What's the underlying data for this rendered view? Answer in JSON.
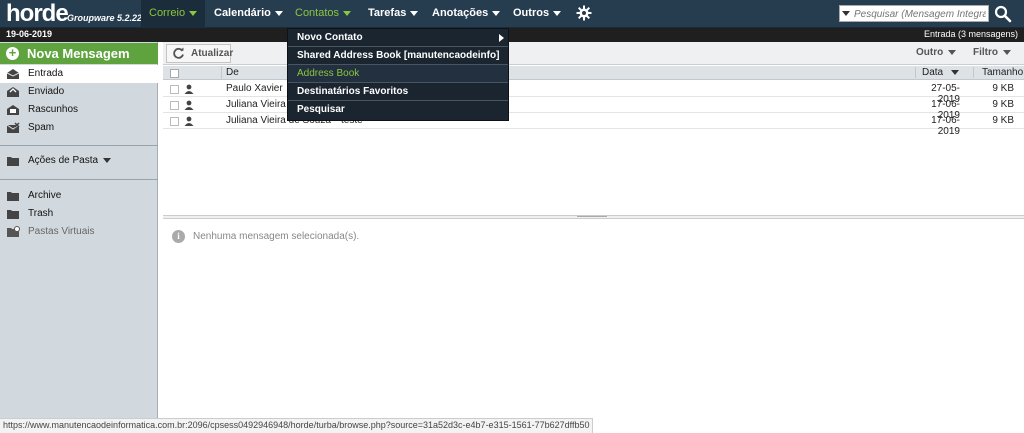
{
  "app": {
    "logo": "horde",
    "version": "Groupware 5.2.22"
  },
  "topmenu": {
    "items": [
      {
        "label": "Correio"
      },
      {
        "label": "Calendário"
      },
      {
        "label": "Contatos"
      },
      {
        "label": "Tarefas"
      },
      {
        "label": "Anotações"
      },
      {
        "label": "Outros"
      }
    ],
    "settings_icon": "gear-icon"
  },
  "search": {
    "placeholder": "Pesquisar (Mensagem Integral)",
    "button_icon": "search-icon"
  },
  "subbar": {
    "date": "19-06-2019",
    "mailbox_status": "Entrada (3 mensagens)"
  },
  "sidebar": {
    "new_message": "Nova Mensagem",
    "folders": [
      {
        "label": "Entrada",
        "icon": "inbox-icon"
      },
      {
        "label": "Enviado",
        "icon": "sent-icon"
      },
      {
        "label": "Rascunhos",
        "icon": "drafts-icon"
      },
      {
        "label": "Spam",
        "icon": "spam-icon"
      }
    ],
    "folder_actions": "Ações de Pasta",
    "other_folders": [
      {
        "label": "Archive",
        "icon": "folder-icon"
      },
      {
        "label": "Trash",
        "icon": "folder-icon"
      },
      {
        "label": "Pastas Virtuais",
        "icon": "virtual-folder-icon"
      }
    ]
  },
  "toolbar": {
    "refresh": "Atualizar",
    "other": "Outro",
    "filter": "Filtro"
  },
  "list": {
    "columns": {
      "from": "De",
      "date": "Data",
      "size": "Tamanho"
    },
    "rows": [
      {
        "from": "Paulo Xavier",
        "subject": "",
        "date": "27-05-2019",
        "size": "9 KB"
      },
      {
        "from": "Juliana Vieira d",
        "subject": "",
        "date": "17-06-2019",
        "size": "9 KB"
      },
      {
        "from": "Juliana Vieira de Souza",
        "subject": "teste",
        "date": "17-06-2019",
        "size": "9 KB"
      }
    ]
  },
  "preview": {
    "empty": "Nenhuma mensagem selecionada(s)."
  },
  "contacts_menu": {
    "items": [
      {
        "label": "Novo Contato"
      },
      {
        "label": "Shared Address Book [manutencaodeinfo]"
      },
      {
        "label": "Address Book"
      },
      {
        "label": "Destinatários Favoritos"
      },
      {
        "label": "Pesquisar"
      }
    ]
  },
  "statusbar": {
    "url": "https://www.manutencaodeinformatica.com.br:2096/cpsess0492946948/horde/turba/browse.php?source=31a52d3c-e4b7-e315-1561-77b627dffb50"
  },
  "colors": {
    "topbar": "#263d50",
    "accent_green": "#8dc63f",
    "new_message_bg": "#5fa33e",
    "sidebar_bg": "#d2d9de"
  }
}
